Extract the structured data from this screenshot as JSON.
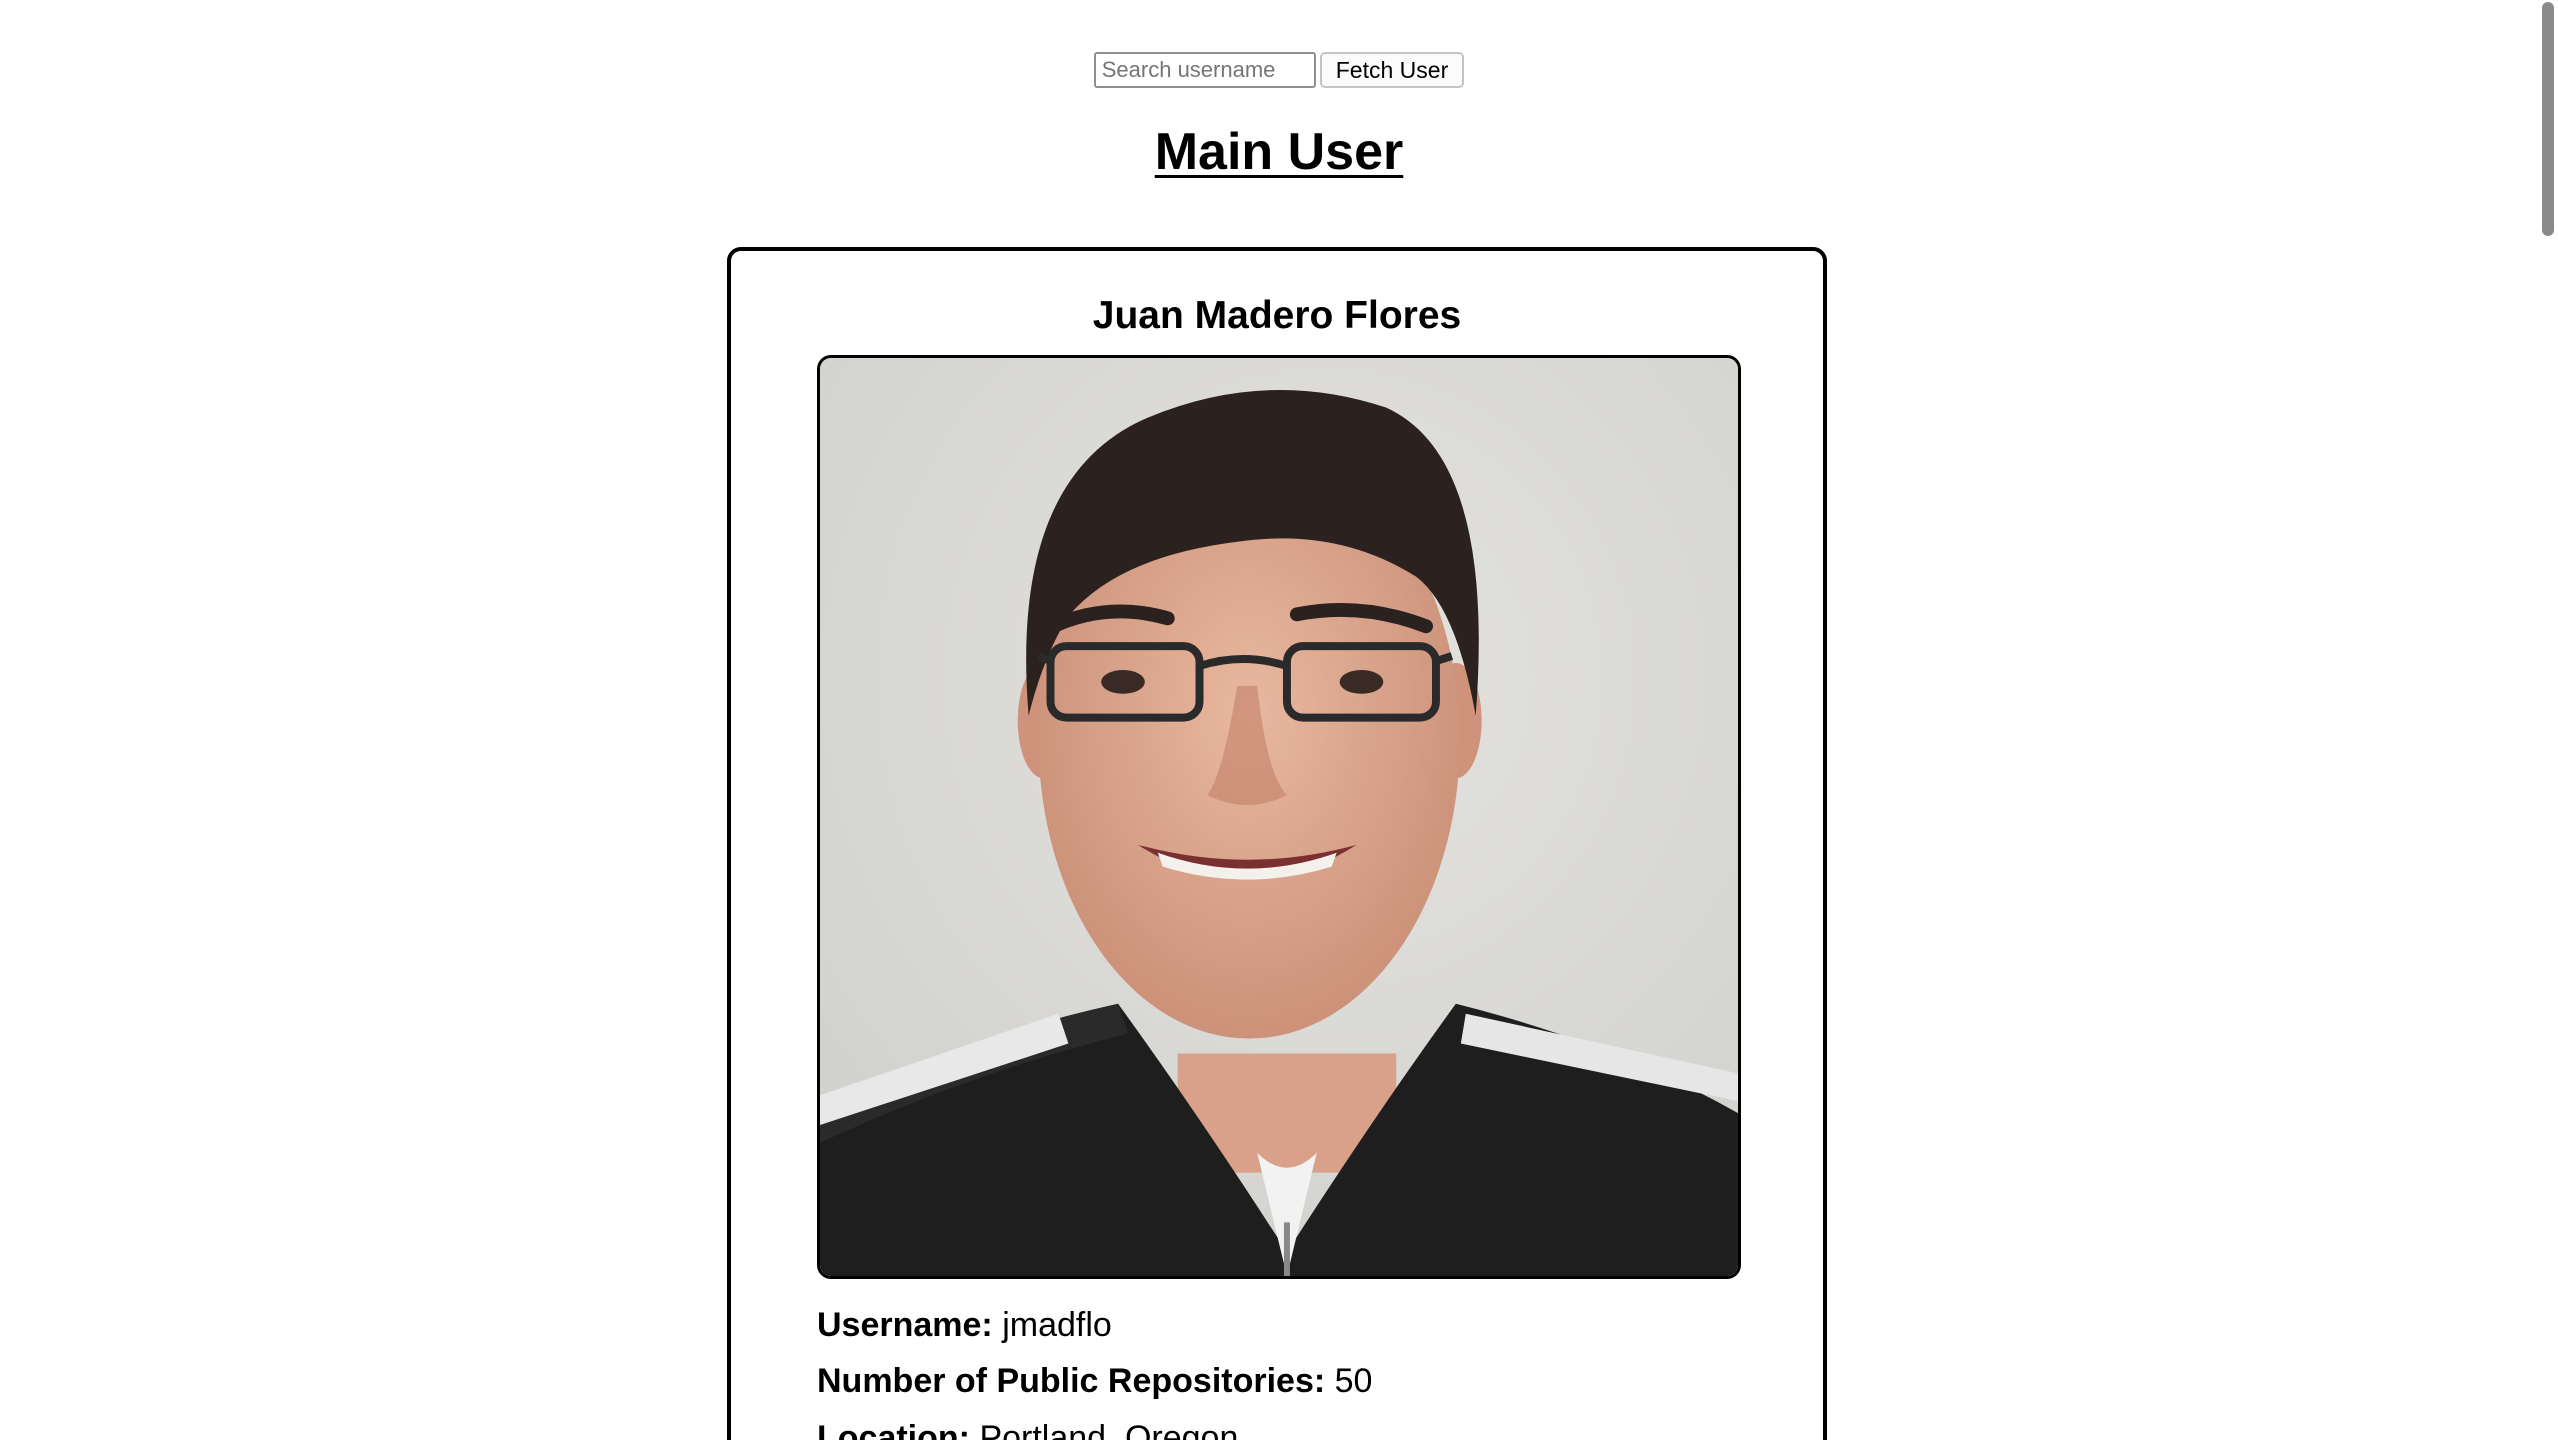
{
  "search": {
    "placeholder": "Search username",
    "value": "",
    "button_label": "Fetch User"
  },
  "heading": "Main User",
  "user": {
    "name": "Juan Madero Flores",
    "username_label": "Username:",
    "username": "jmadflo",
    "repos_label": "Number of Public Repositories:",
    "repos": "50",
    "location_label": "Location:",
    "location": "Portland, Oregon"
  },
  "colors": {
    "card_border": "#000000",
    "page_background": "#ffffff",
    "scrollbar_thumb": "#8a8a8a"
  }
}
